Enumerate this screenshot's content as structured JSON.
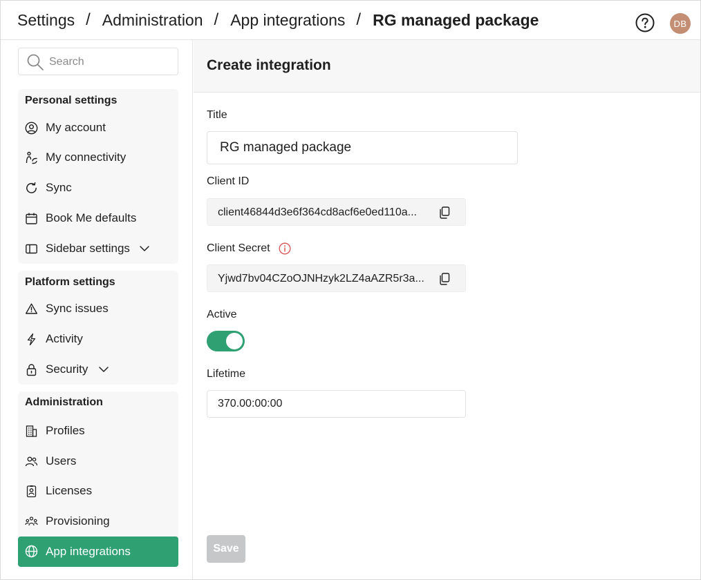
{
  "breadcrumb": [
    {
      "label": "Settings"
    },
    {
      "label": "Administration"
    },
    {
      "label": "App integrations"
    },
    {
      "label": "RG managed package"
    }
  ],
  "breadcrumb_separator": "/",
  "header": {
    "help_icon": "question-circle-icon",
    "avatar_initials": "DB",
    "avatar_color": "#c38e73"
  },
  "search": {
    "placeholder": "Search",
    "value": ""
  },
  "groups": {
    "personal": {
      "title": "Personal settings",
      "items": [
        {
          "label": "My account",
          "icon": "user-circle-icon"
        },
        {
          "label": "My connectivity",
          "icon": "connectivity-icon"
        },
        {
          "label": "Sync",
          "icon": "refresh-icon"
        },
        {
          "label": "Book Me defaults",
          "icon": "calendar-icon"
        },
        {
          "label": "Sidebar settings",
          "icon": "sidebar-panel-icon"
        }
      ]
    },
    "platform": {
      "title": "Platform settings",
      "items": [
        {
          "label": "Sync issues",
          "icon": "warning-triangle-icon"
        },
        {
          "label": "Activity",
          "icon": "lightning-icon"
        },
        {
          "label": "Security",
          "icon": "lock-icon"
        }
      ]
    },
    "administration": {
      "title": "Administration",
      "items": [
        {
          "label": "Profiles",
          "icon": "building-icon"
        },
        {
          "label": "Users",
          "icon": "users-icon"
        },
        {
          "label": "Licenses",
          "icon": "badge-icon"
        },
        {
          "label": "Provisioning",
          "icon": "user-group-icon"
        },
        {
          "label": "App integrations",
          "icon": "globe-icon",
          "active": true
        }
      ]
    }
  },
  "main": {
    "title": "Create integration",
    "fields": {
      "title_label": "Title",
      "title_value": "RG managed package",
      "client_id_label": "Client ID",
      "client_id_value": "client46844d3e6f364cd8acf6e0ed110a...",
      "client_secret_label": "Client Secret",
      "client_secret_value": "Yjwd7bv04CZoOJNHzyk2LZ4aAZR5r3a...",
      "active_label": "Active",
      "active": true,
      "lifetime_label": "Lifetime",
      "lifetime_value": "370.00:00:00"
    },
    "save_label": "Save"
  },
  "colors": {
    "accent": "#2ea072",
    "disabled_button": "#c6c7c9",
    "info_icon": "#d9534f"
  }
}
